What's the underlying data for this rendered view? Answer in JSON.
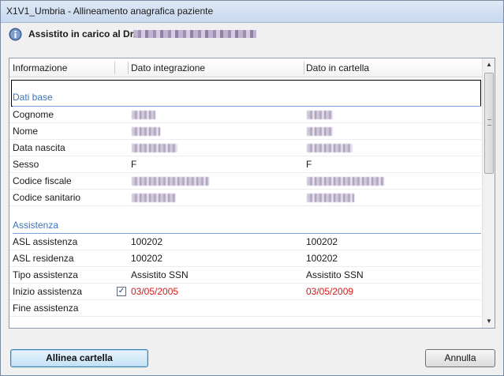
{
  "window": {
    "title": "X1V1_Umbria - Allineamento anagrafica paziente"
  },
  "subheader": {
    "label": "Assistito in carico al Dr.",
    "icon": "info-icon"
  },
  "table": {
    "columns": [
      "Informazione",
      "Dato integrazione",
      "Dato in cartella"
    ],
    "sections": [
      {
        "title": "Dati base",
        "rows": [
          {
            "label": "Cognome",
            "integrazione": "",
            "cartella": ""
          },
          {
            "label": "Nome",
            "integrazione": "",
            "cartella": ""
          },
          {
            "label": "Data nascita",
            "integrazione": "",
            "cartella": ""
          },
          {
            "label": "Sesso",
            "integrazione": "F",
            "cartella": "F"
          },
          {
            "label": "Codice fiscale",
            "integrazione": "",
            "cartella": ""
          },
          {
            "label": "Codice sanitario",
            "integrazione": "",
            "cartella": ""
          }
        ]
      },
      {
        "title": "Assistenza",
        "rows": [
          {
            "label": "ASL assistenza",
            "integrazione": "100202",
            "cartella": "100202"
          },
          {
            "label": "ASL residenza",
            "integrazione": "100202",
            "cartella": "100202"
          },
          {
            "label": "Tipo assistenza",
            "integrazione": "Assistito SSN",
            "cartella": "Assistito SSN"
          },
          {
            "label": "Inizio assistenza",
            "integrazione": "03/05/2005",
            "cartella": "03/05/2009",
            "checked": true,
            "mismatch": true
          },
          {
            "label": "Fine assistenza",
            "integrazione": "",
            "cartella": ""
          }
        ]
      }
    ]
  },
  "buttons": {
    "align_label": "Allinea cartella",
    "cancel_label": "Annulla"
  },
  "colors": {
    "accent": "#3b73b9",
    "mismatch": "#d21a1a"
  }
}
